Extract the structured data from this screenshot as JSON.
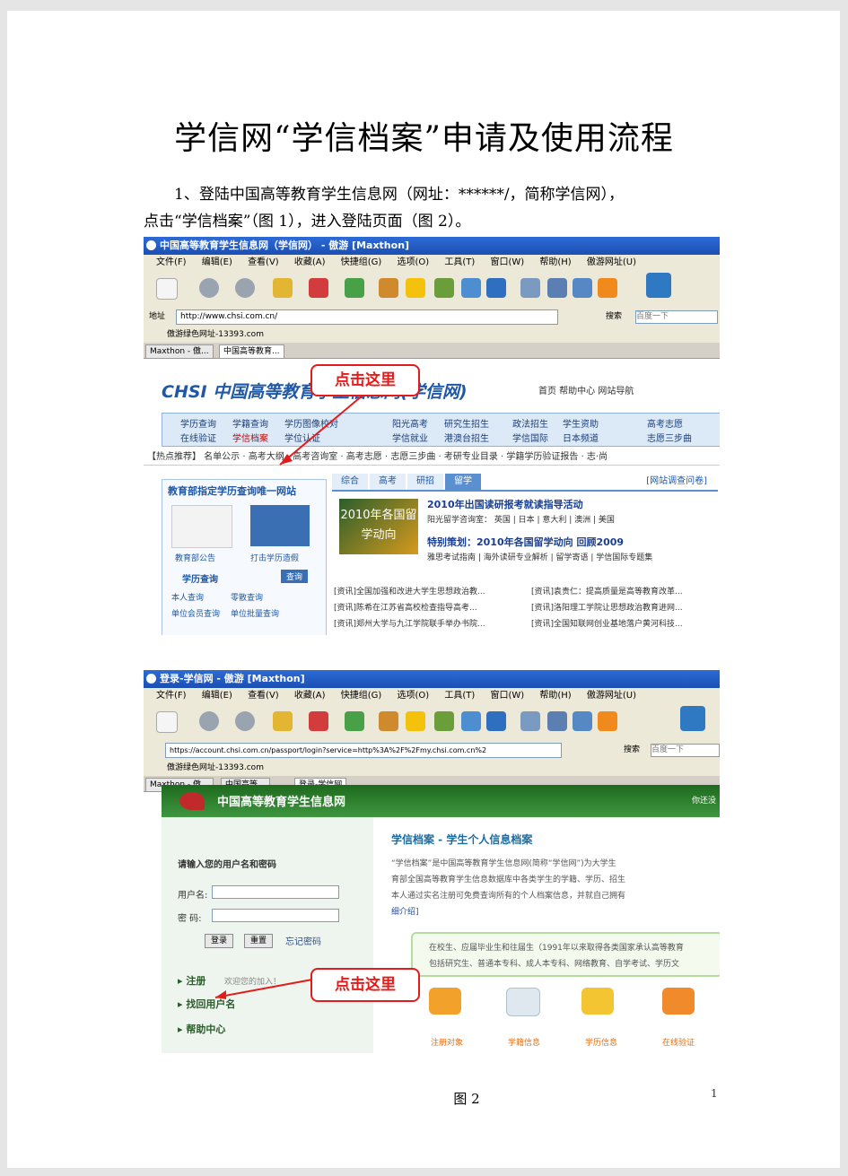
{
  "document": {
    "title": "学信网“学信档案”申请及使用流程",
    "paragraph_1a": "1、登陆中国高等教育学生信息网（网址：******/，简称学信网），",
    "paragraph_1b": "点击“学信档案”（图 1），进入登陆页面（图 2）。",
    "caption_fig2": "图 2",
    "page_number": "1"
  },
  "screenshot_1": {
    "window_title": "中国高等教育学生信息网（学信网） - 傲游 [Maxthon]",
    "menu": [
      "文件(F)",
      "编辑(E)",
      "查看(V)",
      "收藏(A)",
      "快捷组(G)",
      "选项(O)",
      "工具(T)",
      "窗口(W)",
      "帮助(H)",
      "傲游网址(U)"
    ],
    "address_label": "地址",
    "address": "http://www.chsi.com.cn/",
    "search_label": "搜索",
    "search_placeholder": "百度一下",
    "favorite": "傲游绿色网址-13393.com",
    "tab_1": "Maxthon - 傲...",
    "tab_2": "中国高等教育...",
    "site_logo": "CHSI 中国高等教育学生信息网(学信网)",
    "top_links": "首页   帮助中心   网站导航",
    "nav_row1": [
      "学历查询",
      "学籍查询",
      "学历图像校对",
      "阳光高考",
      "研究生招生",
      "政法招生",
      "学生资助",
      "高考志愿"
    ],
    "nav_row2": [
      "在线验证",
      "学信档案",
      "学位认证",
      "学信就业",
      "港澳台招生",
      "学信国际",
      "日本频道",
      "志愿三步曲"
    ],
    "hotbar": "【热点推荐】 名单公示 · 高考大纲 · 高考咨询室 · 高考志愿 · 志愿三步曲 · 考研专业目录 · 学籍学历验证报告 · 志·尚",
    "left_box_title": "教育部指定学历查询唯一网站",
    "left_captions": [
      "教育部公告",
      "打击学历造假"
    ],
    "xueli_title": "学历查询",
    "xueli_btn": "查询",
    "xueli_links": [
      "本人查询",
      "零散查询",
      "单位会员查询",
      "单位批量查询"
    ],
    "right_tabs": [
      "综合",
      "高考",
      "研招",
      "留学"
    ],
    "right_link": "[网站调查问卷]",
    "img_text": "2010年各国留学动向",
    "headline_1": "2010年出国读研报考就读指导活动",
    "sub_1": "阳光留学咨询室： 英国 | 日本 | 意大利 | 澳洲 | 美国",
    "headline_2": "特别策划：2010年各国留学动向 回顾2009",
    "sub_2": "雅思考试指南 | 海外读研专业解析 | 留学寄语 | 学信国际专题集",
    "news": [
      "[资讯]全国加强和改进大学生思想政治教...",
      "[资讯]袁贵仁：提高质量是高等教育改革...",
      "[资讯]陈希在江苏省高校检查指导高考...",
      "[资讯]洛阳理工学院让思想政治教育进网...",
      "[资讯]郑州大学与九江学院联手举办书院...",
      "[资讯]全国知联网创业基地落户黄河科技..."
    ],
    "callout": "点击这里"
  },
  "screenshot_2": {
    "window_title": "登录-学信网 - 傲游 [Maxthon]",
    "address": "https://account.chsi.com.cn/passport/login?service=http%3A%2F%2Fmy.chsi.com.cn%2",
    "favorite": "傲游绿色网址-13393.com",
    "tab_1": "Maxthon - 傲...",
    "tab_2": "中国高等...",
    "tab_3": "登录-学信网",
    "header": "中国高等教育学生信息网",
    "header_right": "你还没",
    "login_prompt": "请输入您的用户名和密码",
    "username_label": "用户名:",
    "password_label": "密  码:",
    "login_btn": "登录",
    "reset_btn": "重置",
    "forgot": "忘记密码",
    "menu_register": "注册",
    "menu_register_note": "欢迎您的加入！",
    "menu_recover": "找回用户名",
    "menu_help": "帮助中心",
    "right_title": "学信档案 - 学生个人信息档案",
    "right_text_1": "“学信档案”是中国高等教育学生信息网(简称“学信网”)为大学生",
    "right_text_2": "育部全国高等教育学生信息数据库中各类学生的学籍、学历、招生",
    "right_text_3": "本人通过实名注册可免费查询所有的个人档案信息，并就自己拥有",
    "right_text_4": "细介绍]",
    "green_text_1": "在校生、应届毕业生和往届生（1991年以来取得各类国家承认高等教育",
    "green_text_2": "包括研究生、普通本专科、成人本专科、网络教育、自学考试、学历文",
    "icon_labels": [
      "注册对象",
      "学籍信息",
      "学历信息",
      "在线验证"
    ],
    "callout": "点击这里"
  }
}
